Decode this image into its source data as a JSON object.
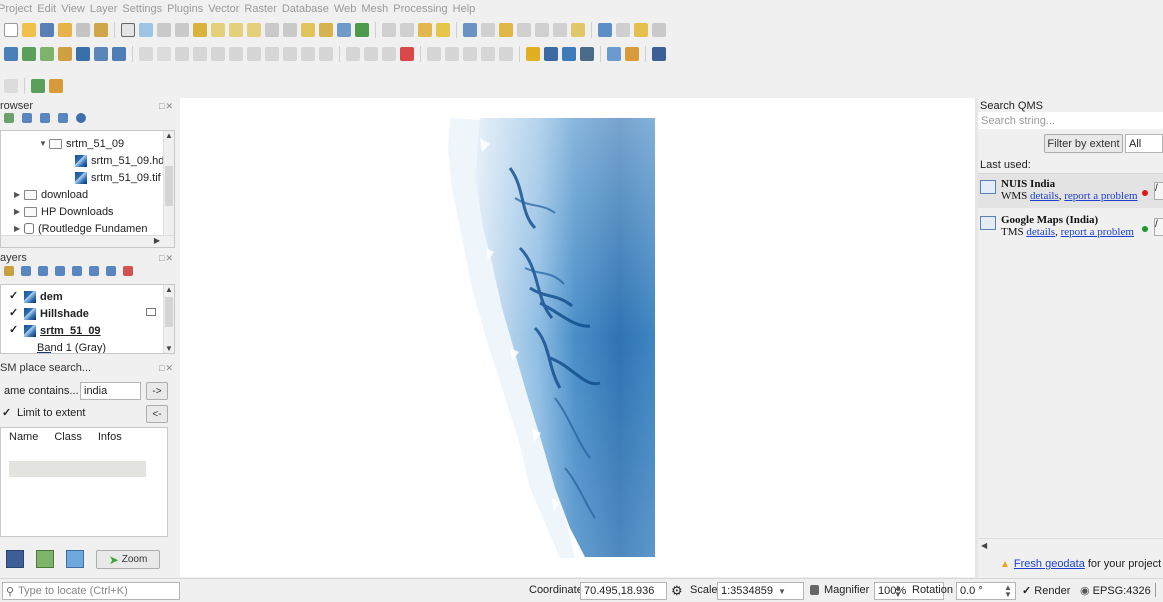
{
  "menubar": [
    "Project",
    "Edit",
    "View",
    "Layer",
    "Settings",
    "Plugins",
    "Vector",
    "Raster",
    "Database",
    "Web",
    "Mesh",
    "Processing",
    "Help"
  ],
  "browser": {
    "title": "rowser",
    "items": [
      {
        "label": "srtm_51_09",
        "kind": "folder-open"
      },
      {
        "label": "srtm_51_09.hd",
        "kind": "raster"
      },
      {
        "label": "srtm_51_09.tif",
        "kind": "raster"
      },
      {
        "label": "download",
        "kind": "folder"
      },
      {
        "label": "HP Downloads",
        "kind": "folder"
      },
      {
        "label": "(Routledge Fundamen",
        "kind": "database"
      }
    ]
  },
  "layers": {
    "title": "ayers",
    "items": [
      {
        "label": "dem",
        "checked": true,
        "bold": true,
        "underline": false
      },
      {
        "label": "Hillshade",
        "checked": true,
        "bold": true,
        "underline": false
      },
      {
        "label": "srtm_51_09",
        "checked": true,
        "bold": true,
        "underline": true
      }
    ],
    "band_label": "Band 1 (Gray)"
  },
  "osm": {
    "title": "SM place search...",
    "name_contains_label": "ame contains...",
    "search_value": "india",
    "go_label": "->",
    "limit_label": "Limit to extent",
    "back_label": "<-",
    "columns": [
      "Name",
      "Class",
      "Infos"
    ]
  },
  "zoom_button": "Zoom",
  "qms": {
    "title": "Search QMS",
    "search_placeholder": "Search string...",
    "filter_label": "Filter by extent",
    "filter_value": "All",
    "last_used_label": "Last used:",
    "services": [
      {
        "name": "NUIS India",
        "type": "WMS",
        "details": "details",
        "report": "report a problem",
        "status_color": "#e01818"
      },
      {
        "name": "Google Maps (India)",
        "type": "TMS",
        "details": "details",
        "report": "report a problem",
        "status_color": "#1a9a2a"
      }
    ],
    "footer_link": "Fresh geodata",
    "footer_text": "for your project"
  },
  "status": {
    "locate_placeholder": "Type to locate (Ctrl+K)",
    "coordinate_label": "Coordinate",
    "coordinate_value": "70.495,18.936",
    "scale_label": "Scale",
    "scale_value": "1:3534859",
    "magnifier_label": "Magnifier",
    "magnifier_value": "100%",
    "rotation_label": "Rotation",
    "rotation_value": "0.0 °",
    "render_label": "Render",
    "crs_label": "EPSG:4326"
  },
  "colors": {
    "dem_dark": "#0f4a8a",
    "dem_mid": "#4a8fc9",
    "dem_light": "#c9dff1",
    "link": "#1b3fcf"
  }
}
